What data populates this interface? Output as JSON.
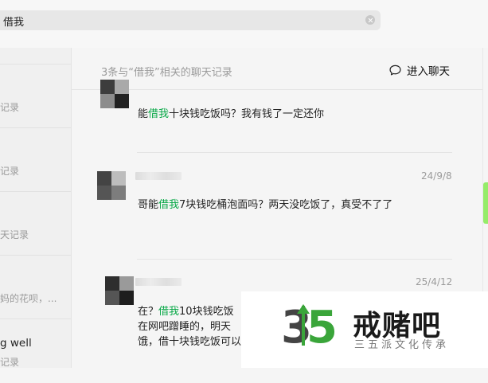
{
  "search": {
    "query": "借我"
  },
  "left_items": [
    {
      "sub": "记录"
    },
    {
      "sub": "记录"
    },
    {
      "sub": "天记录"
    },
    {
      "sub": "妈的花呗，..."
    },
    {
      "title": "g well",
      "sub": "记录"
    }
  ],
  "header": {
    "summary": "3条与“借我”相关的聊天记录",
    "enter_chat": "进入聊天"
  },
  "messages": [
    {
      "date": "",
      "before": "能",
      "keyword": "借我",
      "after": "十块钱吃饭吗？我有钱了一定还你"
    },
    {
      "date": "24/9/8",
      "before": "哥能",
      "keyword": "借我",
      "after": "7块钱吃桶泡面吗？两天没吃饭了，真受不了了"
    },
    {
      "date": "25/4/12",
      "before": "在？",
      "keyword": "借我",
      "after": "10块钱吃饭",
      "line2": "在网吧蹭睡的，明天",
      "line3": "饿，借十块钱吃饭可以"
    }
  ],
  "watermark": {
    "title": "戒赌吧",
    "subtitle": "三五派文化传承",
    "logo_text": "35"
  },
  "colors": {
    "highlight": "#07a846",
    "accent": "#95ec69"
  }
}
